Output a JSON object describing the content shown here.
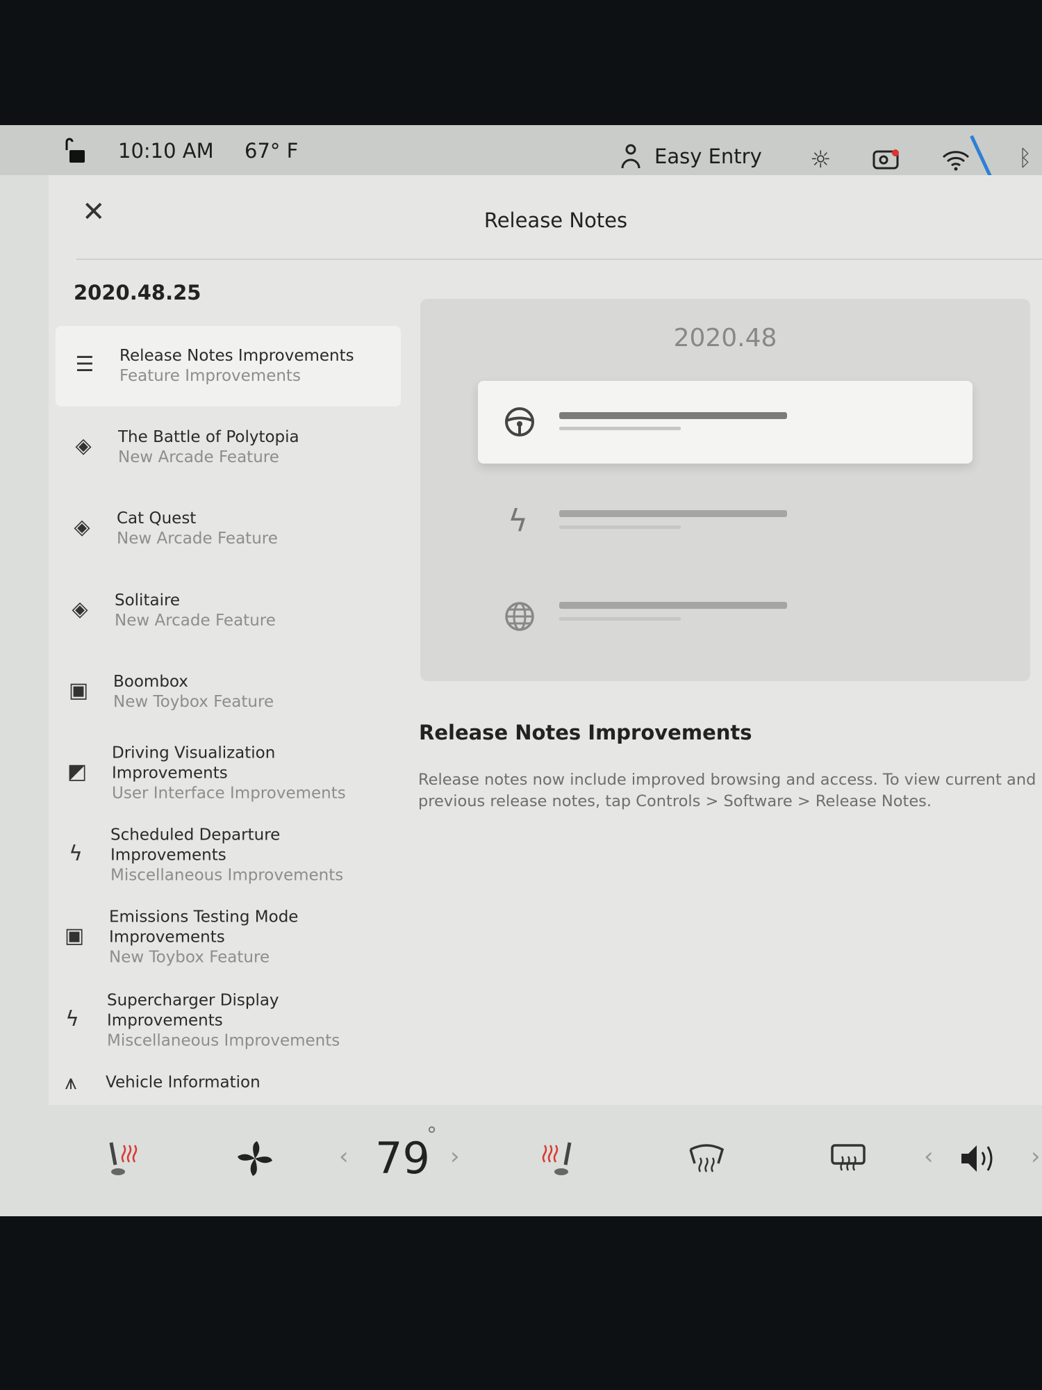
{
  "status": {
    "time": "10:10 AM",
    "temperature": "67° F",
    "profile": "Easy Entry",
    "icons": [
      "lock-open-icon",
      "person-icon",
      "sun-icon",
      "dashcam-icon",
      "wifi-icon",
      "bluetooth-icon"
    ],
    "dashcam_dot_color": "#e03030"
  },
  "dialog": {
    "title": "Release Notes",
    "close_icon": "close-icon"
  },
  "sidebar": {
    "version": "2020.48.25",
    "items": [
      {
        "title": "Release Notes Improvements",
        "subtitle": "Feature Improvements",
        "icon": "list-icon",
        "selected": true
      },
      {
        "title": "The Battle of Polytopia",
        "subtitle": "New Arcade Feature",
        "icon": "gamepad-icon"
      },
      {
        "title": "Cat Quest",
        "subtitle": "New Arcade Feature",
        "icon": "gamepad-icon"
      },
      {
        "title": "Solitaire",
        "subtitle": "New Arcade Feature",
        "icon": "gamepad-icon"
      },
      {
        "title": "Boombox",
        "subtitle": "New Toybox Feature",
        "icon": "toybox-icon"
      },
      {
        "title": "Driving Visualization Improvements",
        "subtitle": "User Interface Improvements",
        "icon": "display-icon"
      },
      {
        "title": "Scheduled Departure Improvements",
        "subtitle": "Miscellaneous Improvements",
        "icon": "bolt-icon"
      },
      {
        "title": "Emissions Testing Mode Improvements",
        "subtitle": "New Toybox Feature",
        "icon": "toybox-icon"
      },
      {
        "title": "Supercharger Display Improvements",
        "subtitle": "Miscellaneous Improvements",
        "icon": "bolt-icon"
      },
      {
        "title": "Vehicle Information",
        "subtitle": "",
        "icon": "car-icon"
      }
    ]
  },
  "preview": {
    "version": "2020.48",
    "rows": [
      "steering-wheel-icon",
      "bolt-icon",
      "globe-icon"
    ]
  },
  "detail": {
    "heading": "Release Notes Improvements",
    "body": "Release notes now include improved browsing and access. To view current and previous release notes, tap Controls > Software > Release Notes."
  },
  "climate": {
    "temperature": "79",
    "degree": "°",
    "heat_color": "#d83a34"
  }
}
